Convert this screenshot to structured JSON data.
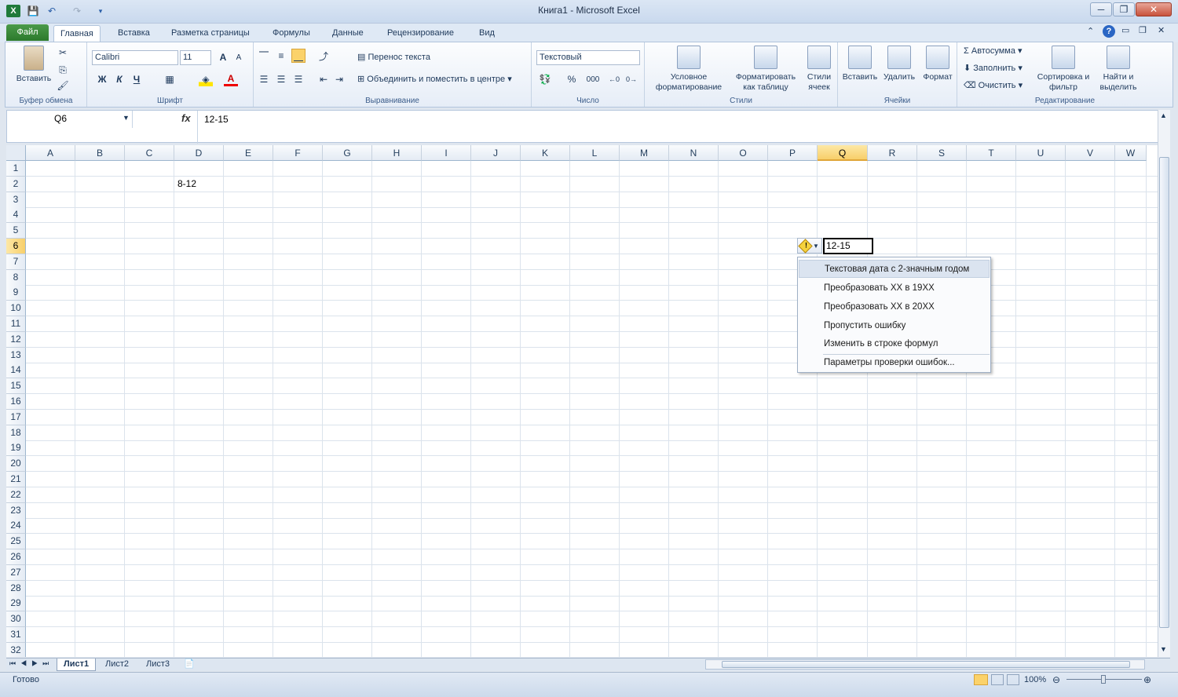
{
  "window": {
    "app_title": "Книга1 - Microsoft Excel",
    "title_doc": "Книга1",
    "title_app": "Microsoft Excel",
    "minimize": "─",
    "restore": "❐",
    "close": "✕"
  },
  "tabs": {
    "file": "Файл",
    "items": [
      "Главная",
      "Вставка",
      "Разметка страницы",
      "Формулы",
      "Данные",
      "Рецензирование",
      "Вид"
    ]
  },
  "ribbon": {
    "clipboard": {
      "paste": "Вставить",
      "label": "Буфер обмена"
    },
    "font": {
      "name": "Calibri",
      "size": "11",
      "bold": "Ж",
      "italic": "К",
      "underline": "Ч",
      "grow": "A",
      "shrink": "A",
      "color_letter": "A",
      "label": "Шрифт"
    },
    "alignment": {
      "wrap": "Перенос текста",
      "merge": "Объединить и поместить в центре",
      "label": "Выравнивание"
    },
    "number": {
      "format": "Текстовый",
      "percent": "%",
      "thousands": "000",
      "label": "Число"
    },
    "styles": {
      "conditional": "Условное форматирование",
      "as_table": "Форматировать как таблицу",
      "cell_styles": "Стили ячеек",
      "label": "Стили"
    },
    "cells": {
      "insert": "Вставить",
      "delete": "Удалить",
      "format": "Формат",
      "label": "Ячейки"
    },
    "editing": {
      "autosum": "Автосумма",
      "fill": "Заполнить",
      "clear": "Очистить",
      "sort": "Сортировка и фильтр",
      "find": "Найти и выделить",
      "label": "Редактирование"
    }
  },
  "formula_bar": {
    "name_box": "Q6",
    "fx": "fx",
    "content": "12-15"
  },
  "grid": {
    "columns": [
      "A",
      "B",
      "C",
      "D",
      "E",
      "F",
      "G",
      "H",
      "I",
      "J",
      "K",
      "L",
      "M",
      "N",
      "O",
      "P",
      "Q",
      "R",
      "S",
      "T",
      "U",
      "V",
      "W"
    ],
    "rows": [
      "1",
      "2",
      "3",
      "4",
      "5",
      "6",
      "7",
      "8",
      "9",
      "10",
      "11",
      "12",
      "13",
      "14",
      "15",
      "16",
      "17",
      "18",
      "19",
      "20",
      "21",
      "22",
      "23",
      "24",
      "25",
      "26",
      "27",
      "28",
      "29",
      "30",
      "31",
      "32"
    ],
    "selected_column": "Q",
    "selected_row": "6",
    "cells": {
      "D2": "8-12",
      "Q6": "12-15"
    }
  },
  "error_menu": {
    "icon": "!",
    "items": [
      "Текстовая дата с 2-значным годом",
      "Преобразовать XX в 19XX",
      "Преобразовать XX в 20XX",
      "Пропустить ошибку",
      "Изменить в строке формул",
      "Параметры проверки ошибок..."
    ]
  },
  "sheets": [
    "Лист1",
    "Лист2",
    "Лист3"
  ],
  "status": {
    "ready": "Готово",
    "zoom": "100%"
  },
  "colors": {
    "accent": "#2c7a2c",
    "selection": "#f8cf6a",
    "ribbon": "#e6edf7"
  }
}
